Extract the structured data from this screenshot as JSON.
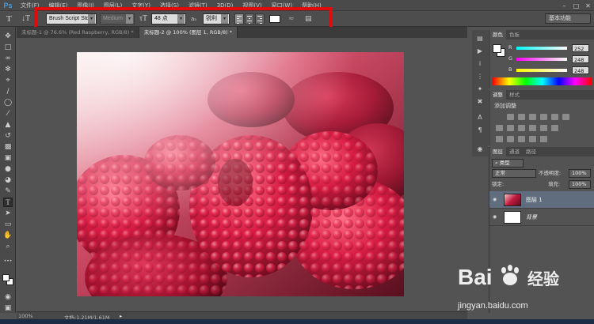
{
  "app": {
    "logo": "Ps"
  },
  "menu": [
    "文件(F)",
    "编辑(E)",
    "图像(I)",
    "图层(L)",
    "文字(Y)",
    "选择(S)",
    "滤镜(T)",
    "3D(D)",
    "视图(V)",
    "窗口(W)",
    "帮助(H)"
  ],
  "options": {
    "font_family": "Brush Script Std",
    "font_style": "Medium",
    "font_size": "48 点",
    "aa_label": "aₐ",
    "antialias": "锐利",
    "workspace": "基本功能",
    "text_color": "#ffffff"
  },
  "tabs": [
    {
      "label": "未标题-1 @ 76.6% (Red Raspberry, RGB/8) *",
      "active": false
    },
    {
      "label": "未标题-2 @ 100% (图层 1, RGB/8) *",
      "active": true
    }
  ],
  "status": {
    "zoom": "100%",
    "doc": "文档:1.21M/1.61M"
  },
  "color_panel": {
    "tabs": [
      "颜色",
      "色板"
    ],
    "r_label": "R",
    "r": "252",
    "g_label": "G",
    "g": "248",
    "b_label": "B",
    "b": "248"
  },
  "adjust_panel": {
    "tabs": [
      "调整",
      "样式"
    ],
    "title": "添加调整"
  },
  "layers_panel": {
    "tabs": [
      "图层",
      "通道",
      "路径"
    ],
    "kind": "⌕ 类型",
    "blend": "正常",
    "opacity_label": "不透明度:",
    "opacity": "100%",
    "lock_label": "锁定:",
    "fill_label": "填充:",
    "fill": "100%",
    "layers": [
      {
        "name": "图层 1",
        "selected": true
      },
      {
        "name": "背景",
        "selected": false
      }
    ]
  },
  "watermark": {
    "logo_text": "Bai  经验",
    "url": "jingyan.baidu.com"
  },
  "colors": {
    "highlight": "#e10b0b",
    "accent": "#3a9fe8"
  }
}
